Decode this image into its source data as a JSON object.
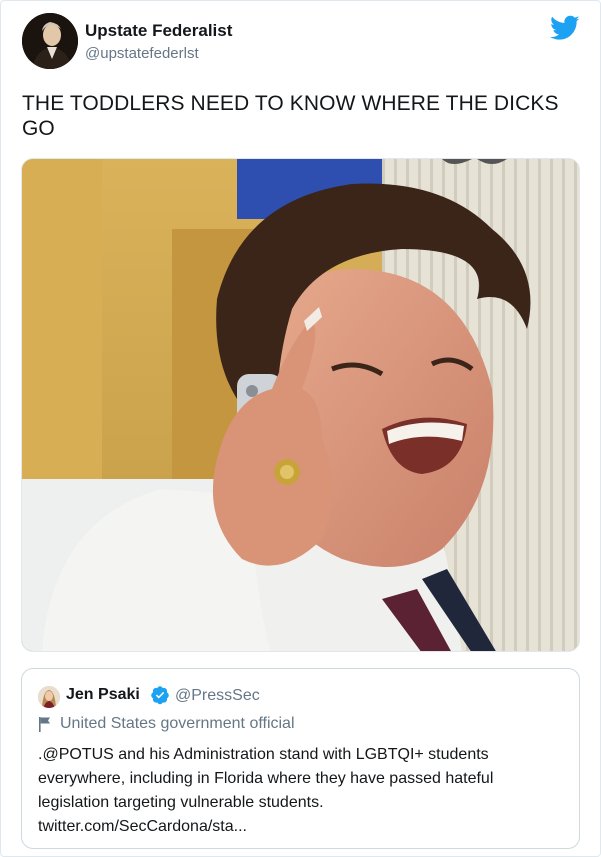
{
  "author": {
    "name": "Upstate Federalist",
    "handle": "@upstatefederlst",
    "avatar_icon": "portrait-avatar"
  },
  "brand_icon": "twitter-bird-icon",
  "brand_color": "#1da1f2",
  "tweet": {
    "text": "THE TODDLERS NEED TO KNOW WHERE THE DICKS GO"
  },
  "media": {
    "type": "photo"
  },
  "quoted_tweet": {
    "name": "Jen Psaki",
    "handle": "@PressSec",
    "verified": true,
    "label_icon": "flag-icon",
    "label": "United States government official",
    "text_lines": [
      ".@POTUS and his Administration stand with LGBTQI+ students",
      "everywhere, including in Florida where they have passed hateful",
      "legislation targeting vulnerable students.",
      "twitter.com/SecCardona/sta..."
    ]
  }
}
